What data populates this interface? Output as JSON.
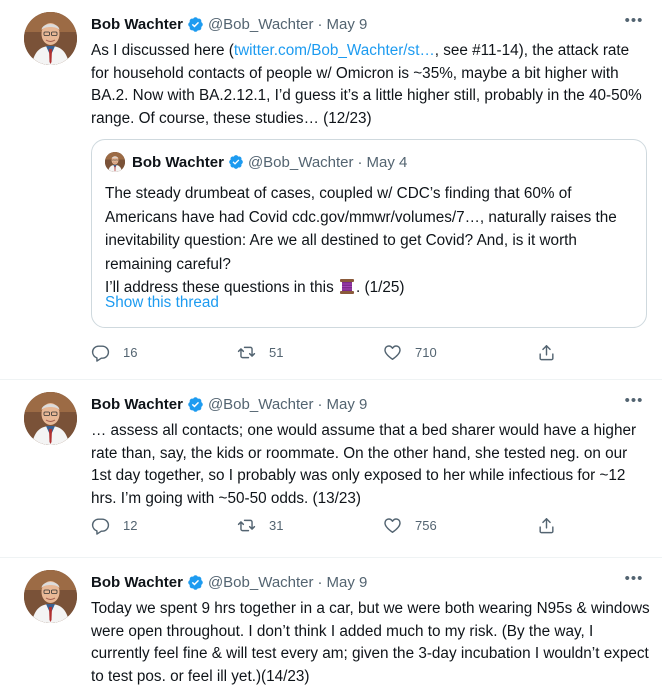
{
  "tweets": [
    {
      "author": "Bob Wachter",
      "handle": "@Bob_Wachter",
      "separator": "·",
      "date": "May 9",
      "text_before_link": "As I discussed here (",
      "link": "twitter.com/Bob_Wachter/st…",
      "text_after_link": ", see #11-14), the attack rate for household contacts of people w/ Omicron is ~35%, maybe a bit higher with BA.2. Now with BA.2.12.1, I’d guess it’s a little higher still, probably in the 40-50% range. Of course, these studies… (12/23)",
      "quote": {
        "author": "Bob Wachter",
        "handle": "@Bob_Wachter",
        "separator": "·",
        "date": "May 4",
        "text_main": "The steady drumbeat of cases, coupled w/ CDC’s finding that 60% of Americans have had Covid cdc.gov/mmwr/volumes/7…, naturally raises the inevitability question: Are we all destined to get Covid? And, is it worth remaining careful?",
        "text_last_before": "I’ll address these questions in this ",
        "text_last_after": ". (1/25)",
        "emoji": "thread-spool-icon",
        "show_thread": "Show this thread"
      },
      "replies": "16",
      "retweets": "51",
      "likes": "710"
    },
    {
      "author": "Bob Wachter",
      "handle": "@Bob_Wachter",
      "separator": "·",
      "date": "May 9",
      "text": "… assess all contacts; one would assume that a bed sharer would have a higher rate than, say, the kids or roommate. On the other hand, she tested neg. on our 1st day together, so I probably was only exposed to her while infectious for ~12 hrs. I’m going with ~50-50 odds. (13/23)",
      "replies": "12",
      "retweets": "31",
      "likes": "756"
    },
    {
      "author": "Bob Wachter",
      "handle": "@Bob_Wachter",
      "separator": "·",
      "date": "May 9",
      "text": "Today we spent 9 hrs together in a car, but we were both wearing N95s & windows were open throughout. I don’t think I added much to my risk. (By the way, I currently feel fine & will test every am; given the 3-day incubation I wouldn’t expect to test pos. or feel ill yet.)(14/23)"
    }
  ],
  "icons": {
    "verified": "verified-badge-icon",
    "more": "more-options-icon",
    "reply": "reply-icon",
    "retweet": "retweet-icon",
    "like": "like-icon",
    "share": "share-icon"
  },
  "colors": {
    "accent": "#1d9bf0",
    "text": "#0f1419",
    "secondary": "#536471",
    "border": "#cfd9de"
  }
}
